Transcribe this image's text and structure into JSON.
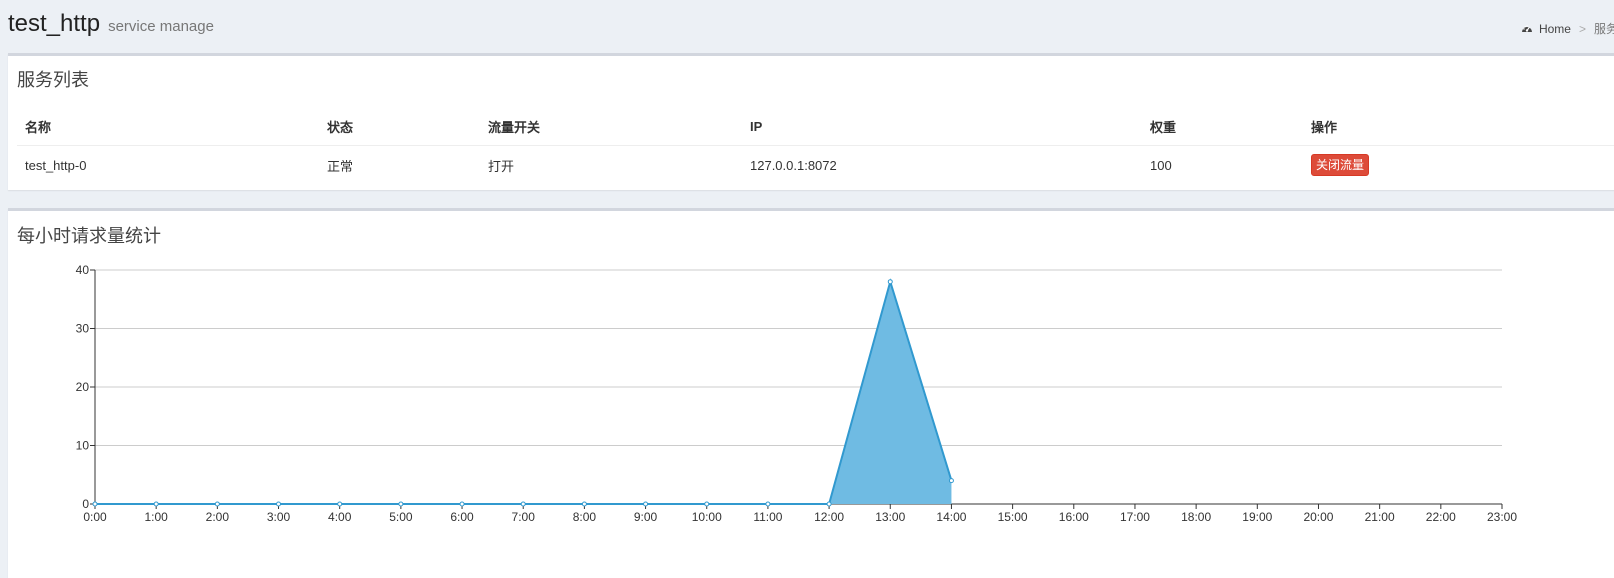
{
  "header": {
    "title": "test_http",
    "subtitle": "service manage",
    "breadcrumb": {
      "home_label": "Home",
      "separator": ">",
      "current": "服务"
    }
  },
  "services": {
    "title": "服务列表",
    "columns": [
      "名称",
      "状态",
      "流量开关",
      "IP",
      "权重",
      "操作"
    ],
    "rows": [
      {
        "name": "test_http-0",
        "status": "正常",
        "flow_switch": "打开",
        "ip": "127.0.0.1:8072",
        "weight": "100",
        "action_label": "关闭流量"
      }
    ]
  },
  "stats": {
    "title": "每小时请求量统计"
  },
  "colors": {
    "accent_fill": "#6fbbe3",
    "accent_line": "#3199cf",
    "status_green": "#008d4c",
    "danger": "#dd4b39"
  },
  "chart_data": {
    "type": "area",
    "categories": [
      "0:00",
      "1:00",
      "2:00",
      "3:00",
      "4:00",
      "5:00",
      "6:00",
      "7:00",
      "8:00",
      "9:00",
      "10:00",
      "11:00",
      "12:00",
      "13:00",
      "14:00",
      "15:00",
      "16:00",
      "17:00",
      "18:00",
      "19:00",
      "20:00",
      "21:00",
      "22:00",
      "23:00"
    ],
    "values": [
      0,
      0,
      0,
      0,
      0,
      0,
      0,
      0,
      0,
      0,
      0,
      0,
      0,
      38,
      4
    ],
    "yticks": [
      "0",
      "10",
      "20",
      "30",
      "40"
    ],
    "ylim": [
      0,
      40
    ],
    "grid": true,
    "legend": "none"
  }
}
